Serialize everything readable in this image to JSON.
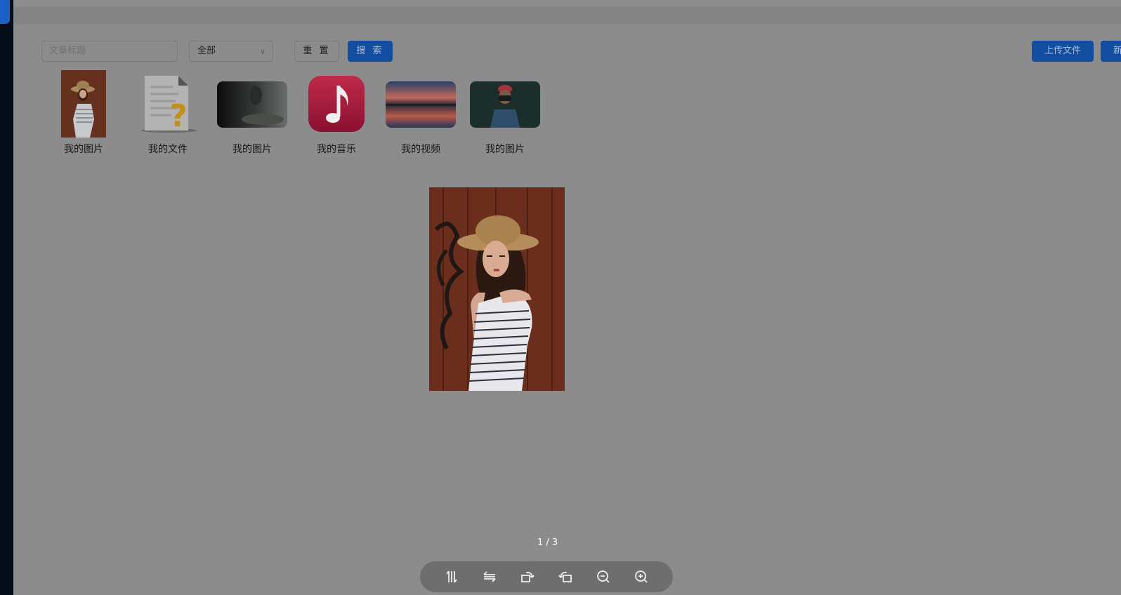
{
  "toolbar": {
    "search_placeholder": "文章标题",
    "category_value": "全部",
    "reset_label": "重 置",
    "search_label": "搜 索",
    "upload_label": "上传文件",
    "new_label": "新"
  },
  "files": [
    {
      "label": "我的图片",
      "kind": "portrait-photo"
    },
    {
      "label": "我的文件",
      "kind": "unknown-file-icon"
    },
    {
      "label": "我的图片",
      "kind": "dark-photo"
    },
    {
      "label": "我的音乐",
      "kind": "music-icon"
    },
    {
      "label": "我的视频",
      "kind": "sunset-video"
    },
    {
      "label": "我的图片",
      "kind": "camera-photo"
    }
  ],
  "viewer": {
    "counter": "1 / 3",
    "tools": [
      "flip-vertical-icon",
      "flip-horizontal-icon",
      "rotate-right-icon",
      "rotate-left-icon",
      "zoom-out-icon",
      "zoom-in-icon"
    ]
  },
  "colors": {
    "overlay_bg": "#8b8b8b",
    "primary_button": "#124da0",
    "sidebar": "#050d18",
    "sidebar_active": "#1a5fc8"
  }
}
